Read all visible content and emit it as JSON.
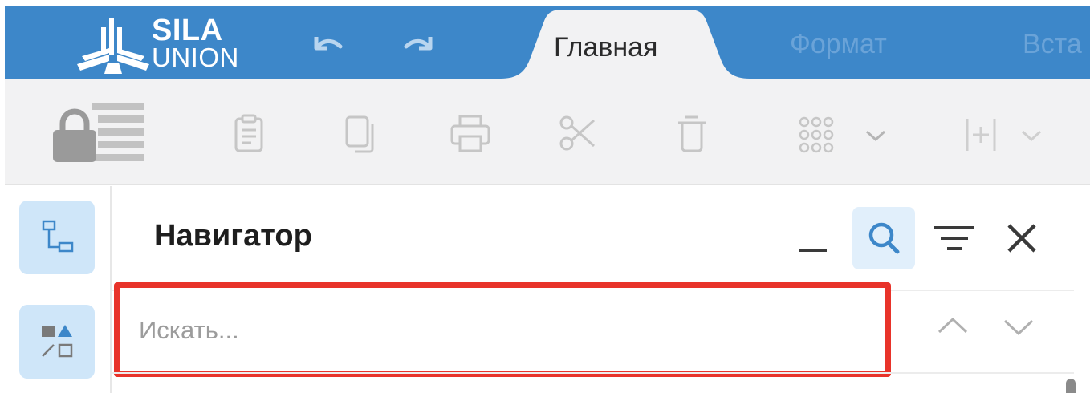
{
  "app": {
    "logo_line1": "SILA",
    "logo_line2": "UNION"
  },
  "quick_access": {
    "undo_icon": "undo-arrow-icon",
    "redo_icon": "redo-arrow-icon"
  },
  "tabs": [
    {
      "label": "Главная",
      "active": true
    },
    {
      "label": "Формат",
      "active": false
    },
    {
      "label": "Вста",
      "active": false
    }
  ],
  "toolbar": {
    "icons": [
      "lock-list-icon",
      "paste-icon",
      "copy-icon",
      "print-icon",
      "cut-icon",
      "delete-icon",
      "grid-dots-icon",
      "insert-field-icon"
    ]
  },
  "navigator": {
    "title": "Навигатор",
    "search_placeholder": "Искать..."
  },
  "colors": {
    "topbar": "#3d87c9",
    "accent_light": "#cfe6f9",
    "highlight_border": "#e8332a",
    "icon_gray": "#b5b5b5"
  }
}
